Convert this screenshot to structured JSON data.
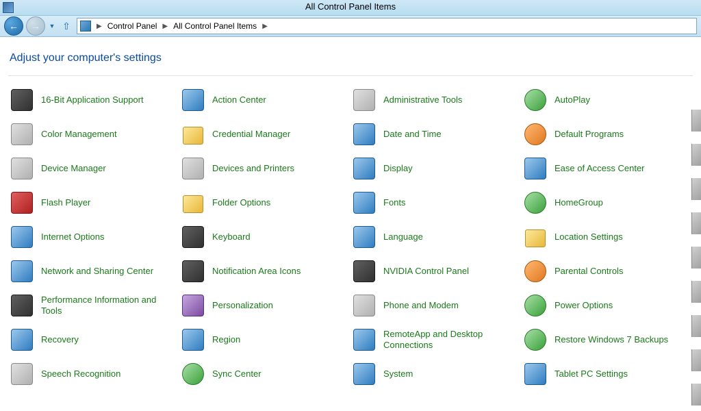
{
  "window": {
    "title": "All Control Panel Items"
  },
  "breadcrumb": {
    "root": "Control Panel",
    "current": "All Control Panel Items"
  },
  "heading": "Adjust your computer's settings",
  "items": [
    {
      "label": "16-Bit Application Support",
      "icon": "dark"
    },
    {
      "label": "Action Center",
      "icon": "blue"
    },
    {
      "label": "Administrative Tools",
      "icon": "generic"
    },
    {
      "label": "AutoPlay",
      "icon": "green"
    },
    {
      "label": "Color Management",
      "icon": "generic"
    },
    {
      "label": "Credential Manager",
      "icon": "yellow"
    },
    {
      "label": "Date and Time",
      "icon": "blue"
    },
    {
      "label": "Default Programs",
      "icon": "orange"
    },
    {
      "label": "Device Manager",
      "icon": "generic"
    },
    {
      "label": "Devices and Printers",
      "icon": "generic"
    },
    {
      "label": "Display",
      "icon": "blue"
    },
    {
      "label": "Ease of Access Center",
      "icon": "blue"
    },
    {
      "label": "Flash Player",
      "icon": "red"
    },
    {
      "label": "Folder Options",
      "icon": "yellow"
    },
    {
      "label": "Fonts",
      "icon": "blue"
    },
    {
      "label": "HomeGroup",
      "icon": "green"
    },
    {
      "label": "Internet Options",
      "icon": "blue"
    },
    {
      "label": "Keyboard",
      "icon": "dark"
    },
    {
      "label": "Language",
      "icon": "blue"
    },
    {
      "label": "Location Settings",
      "icon": "yellow"
    },
    {
      "label": "Network and Sharing Center",
      "icon": "blue"
    },
    {
      "label": "Notification Area Icons",
      "icon": "dark"
    },
    {
      "label": "NVIDIA Control Panel",
      "icon": "dark"
    },
    {
      "label": "Parental Controls",
      "icon": "orange"
    },
    {
      "label": "Performance Information and Tools",
      "icon": "dark"
    },
    {
      "label": "Personalization",
      "icon": "purple"
    },
    {
      "label": "Phone and Modem",
      "icon": "generic"
    },
    {
      "label": "Power Options",
      "icon": "green"
    },
    {
      "label": "Recovery",
      "icon": "blue"
    },
    {
      "label": "Region",
      "icon": "blue"
    },
    {
      "label": "RemoteApp and Desktop Connections",
      "icon": "blue"
    },
    {
      "label": "Restore Windows 7 Backups",
      "icon": "green"
    },
    {
      "label": "Speech Recognition",
      "icon": "generic"
    },
    {
      "label": "Sync Center",
      "icon": "green"
    },
    {
      "label": "System",
      "icon": "blue"
    },
    {
      "label": "Tablet PC Settings",
      "icon": "blue"
    }
  ]
}
